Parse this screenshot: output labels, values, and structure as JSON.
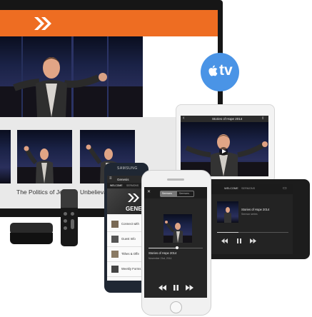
{
  "tv": {
    "thumbnails": [
      {
        "label": "The Politics of Jes"
      },
      {
        "label": "Unbelievab"
      }
    ]
  },
  "apple_tv_badge": {
    "logo_glyph": "",
    "text": "tv"
  },
  "tablet": {
    "title": "Stories of Hope 2014"
  },
  "android_tablet": {
    "tabs": [
      "WELCOME",
      "SERMONS"
    ],
    "title": "Stories of Hope 2014",
    "subtitle": "Sermon series"
  },
  "samsung": {
    "brand": "SAMSUNG",
    "app_title": "Genesis",
    "tabs": [
      "WELCOME",
      "SERMONS"
    ],
    "banner": "GENE",
    "menu": [
      "Connect with",
      "Guest Info",
      "Tithes & Offe",
      "Weekly Forms"
    ]
  },
  "iphone": {
    "tabs": [
      "Sermons",
      "Sermons"
    ],
    "title": "Stories of Hope 2014",
    "subtitle": "November 21st, 2014"
  },
  "colors": {
    "brand_orange": "#ee6d22",
    "apple_blue": "#4a94e6"
  }
}
